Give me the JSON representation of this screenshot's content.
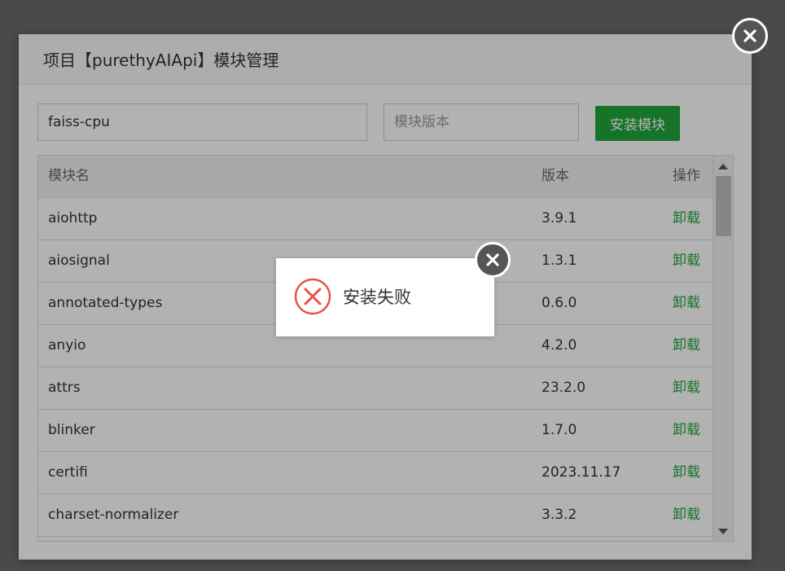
{
  "dialog": {
    "title": "项目【purethyAIApi】模块管理"
  },
  "form": {
    "module_name_value": "faiss-cpu",
    "module_version_placeholder": "模块版本",
    "install_label": "安装模块"
  },
  "table": {
    "headers": {
      "name": "模块名",
      "version": "版本",
      "action": "操作"
    },
    "rows": [
      {
        "name": "aiohttp",
        "version": "3.9.1",
        "action": "卸载"
      },
      {
        "name": "aiosignal",
        "version": "1.3.1",
        "action": "卸载"
      },
      {
        "name": "annotated-types",
        "version": "0.6.0",
        "action": "卸载"
      },
      {
        "name": "anyio",
        "version": "4.2.0",
        "action": "卸载"
      },
      {
        "name": "attrs",
        "version": "23.2.0",
        "action": "卸载"
      },
      {
        "name": "blinker",
        "version": "1.7.0",
        "action": "卸载"
      },
      {
        "name": "certifi",
        "version": "2023.11.17",
        "action": "卸载"
      },
      {
        "name": "charset-normalizer",
        "version": "3.3.2",
        "action": "卸载"
      }
    ]
  },
  "toast": {
    "message": "安装失败",
    "icon": "error-x-circle-icon"
  },
  "colors": {
    "accent_green": "#20a53a",
    "error_red": "#e9524a",
    "overlay": "rgba(0,0,0,0.3)"
  }
}
